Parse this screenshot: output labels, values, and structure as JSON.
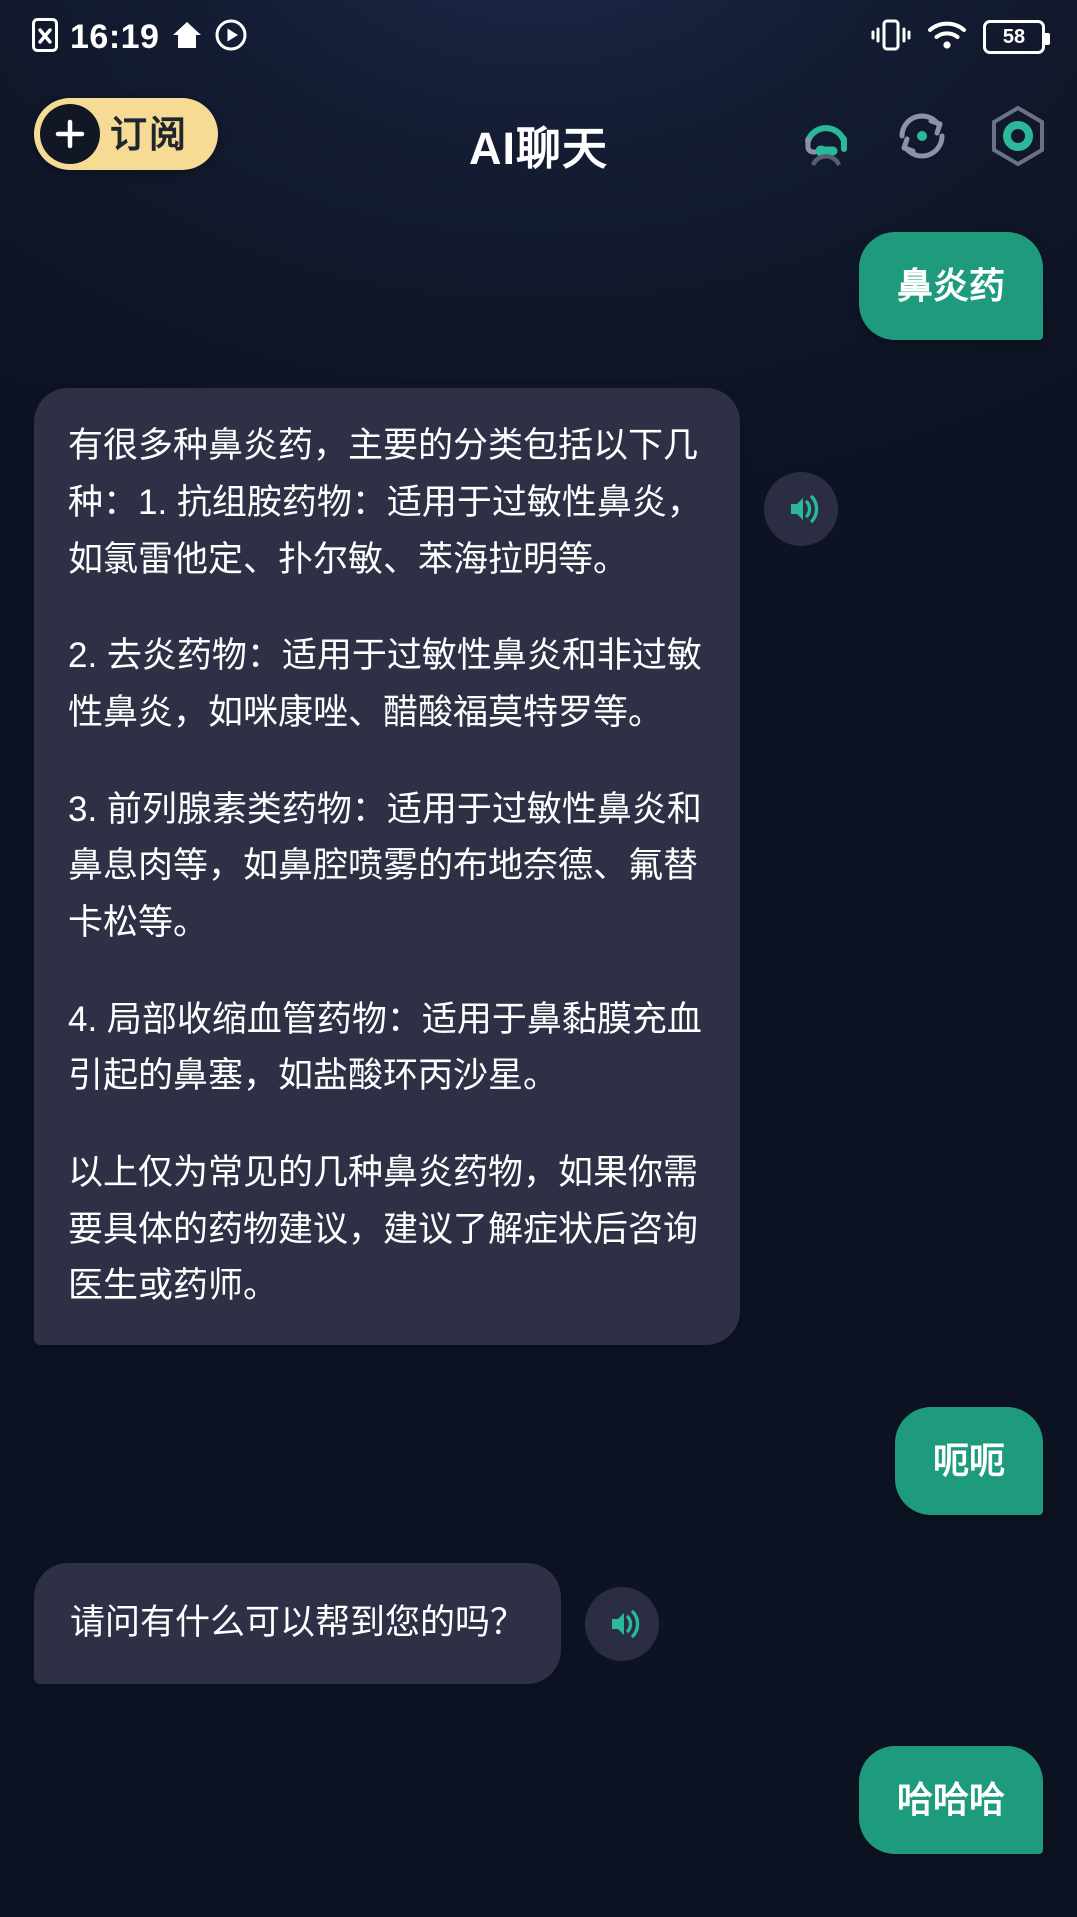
{
  "status_bar": {
    "time": "16:19",
    "battery_level": "58",
    "left_icons": [
      "no-sim-icon",
      "home-icon",
      "play-icon"
    ],
    "right_icons": [
      "vibrate-icon",
      "wifi-icon",
      "battery-icon"
    ]
  },
  "header": {
    "subscribe_label": "订阅",
    "title": "AI聊天",
    "actions": [
      "headset-agent-icon",
      "refresh-icon",
      "hexagon-icon"
    ]
  },
  "theme": {
    "background": "#101729",
    "user_bubble": "#1E9A7C",
    "bot_bubble": "#2e3046",
    "accent_yellow": "#F6DB94",
    "accent_teal": "#2BB898",
    "text": "#ffffff"
  },
  "messages": [
    {
      "role": "user",
      "text": "鼻炎药"
    },
    {
      "role": "bot",
      "tts": "speaker-icon",
      "paragraphs": [
        "有很多种鼻炎药，主要的分类包括以下几种：1. 抗组胺药物：适用于过敏性鼻炎，如氯雷他定、扑尔敏、苯海拉明等。",
        "2. 去炎药物：适用于过敏性鼻炎和非过敏性鼻炎，如咪康唑、醋酸福莫特罗等。",
        "3. 前列腺素类药物：适用于过敏性鼻炎和鼻息肉等，如鼻腔喷雾的布地奈德、氟替卡松等。",
        "4. 局部收缩血管药物：适用于鼻黏膜充血引起的鼻塞，如盐酸环丙沙星。",
        "以上仅为常见的几种鼻炎药物，如果你需要具体的药物建议，建议了解症状后咨询医生或药师。"
      ]
    },
    {
      "role": "user",
      "text": "呃呃"
    },
    {
      "role": "bot",
      "tts": "speaker-icon",
      "paragraphs": [
        "请问有什么可以帮到您的吗？"
      ]
    },
    {
      "role": "user",
      "text": "哈哈哈"
    }
  ]
}
